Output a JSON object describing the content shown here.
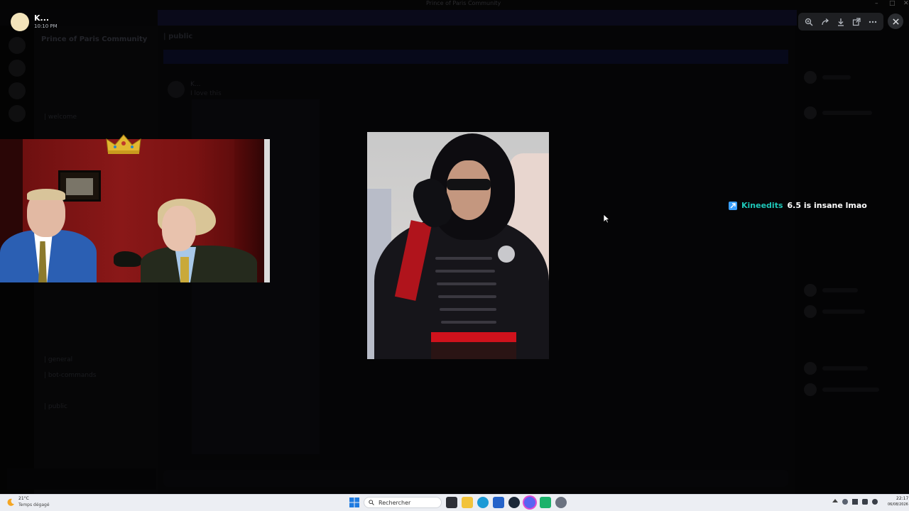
{
  "window": {
    "title": "Prince of Paris Community"
  },
  "background_app": {
    "server_name": "Prince of Paris Community",
    "channels": [
      "| welcome",
      "| general",
      "| bot-commands",
      "| public"
    ],
    "chat_header": "| public",
    "message_author": "K...",
    "message_text": "I love this"
  },
  "viewer": {
    "user_name": "K...",
    "timestamp": "10:10 PM",
    "toolbar": [
      "zoom-icon",
      "share-icon",
      "download-icon",
      "open-external-icon",
      "more-icon"
    ],
    "close_icon": "close-icon"
  },
  "stream_chat": {
    "username": "Kineedits",
    "message": "6.5 is insane lmao",
    "username_color": "#1ec7b8",
    "badge_color": "#3aa0ff"
  },
  "taskbar": {
    "weather_temp": "21°C",
    "weather_desc": "Temps dégagé",
    "search_placeholder": "Rechercher",
    "clock_time": "22:17",
    "clock_date": "06/08/2026",
    "apps": [
      "file-explorer-icon",
      "edge-icon",
      "store-icon",
      "steam-icon",
      "discord-icon",
      "app-icon",
      "settings-icon"
    ]
  }
}
